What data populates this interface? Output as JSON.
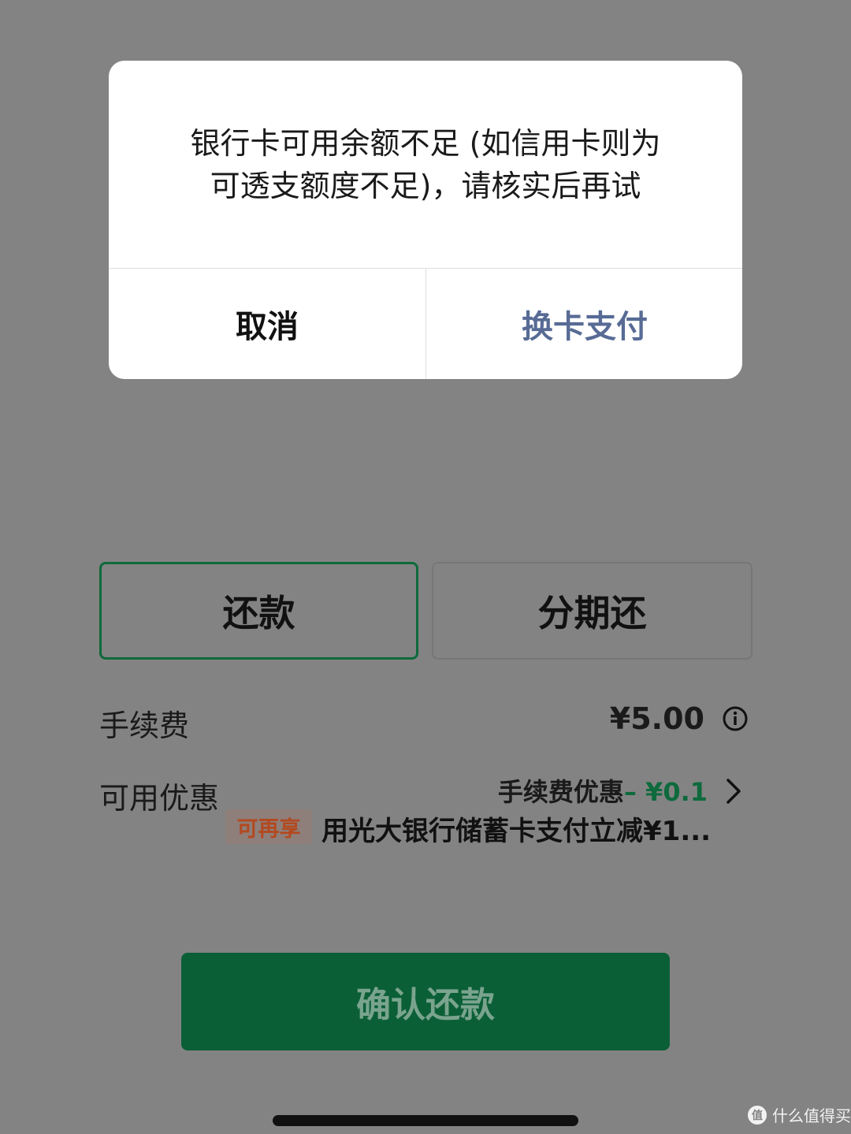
{
  "colors": {
    "overlay_background": "#838383",
    "brand_green": "#0e6a3c",
    "confirm_button": "#0b5f36",
    "dialog_link": "#576b95",
    "badge_text": "#b3491f"
  },
  "dialog": {
    "message_line1": "银行卡可用余额不足 (如信用卡则为",
    "message_line2": "可透支额度不足)，请核实后再试",
    "cancel_label": "取消",
    "switch_card_label": "换卡支付"
  },
  "repay_modes": {
    "repay_label": "还款",
    "installment_label": "分期还",
    "selected": "还款"
  },
  "fee": {
    "label": "手续费",
    "value": "¥5.00",
    "info_icon": "info-icon"
  },
  "discount": {
    "label": "可用优惠",
    "main_text": "手续费优惠",
    "amount": "– ¥0.1",
    "chevron_icon": "chevron-right-icon",
    "badge": "可再享",
    "extra_text": "用光大银行储蓄卡支付立减¥1..."
  },
  "confirm_button_label": "确认还款",
  "watermark": {
    "text": "什么值得买"
  }
}
